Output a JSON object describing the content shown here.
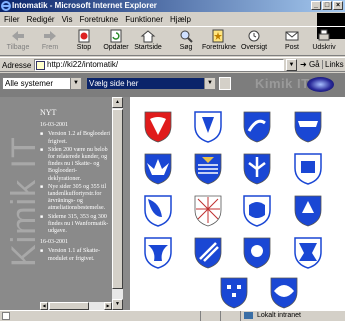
{
  "window": {
    "title": "Intomatik - Microsoft Internet Explorer"
  },
  "menu": [
    "Filer",
    "Redigér",
    "Vis",
    "Foretrukne",
    "Funktioner",
    "Hjælp"
  ],
  "toolbar": [
    {
      "label": "Tilbage",
      "icon": "back-arrow-icon",
      "disabled": true
    },
    {
      "label": "Frem",
      "icon": "forward-arrow-icon",
      "disabled": true
    },
    {
      "label": "Stop",
      "icon": "stop-icon",
      "disabled": false
    },
    {
      "label": "Opdater",
      "icon": "refresh-icon",
      "disabled": false
    },
    {
      "label": "Startside",
      "icon": "home-icon",
      "disabled": false
    },
    {
      "label": "Søg",
      "icon": "search-icon",
      "disabled": false
    },
    {
      "label": "Foretrukne",
      "icon": "favorites-icon",
      "disabled": false
    },
    {
      "label": "Oversigt",
      "icon": "history-icon",
      "disabled": false
    },
    {
      "label": "Post",
      "icon": "mail-icon",
      "disabled": false
    },
    {
      "label": "Udskriv",
      "icon": "print-icon",
      "disabled": false
    }
  ],
  "address": {
    "label": "Adresse",
    "url": "http://ki22/intomatik/",
    "go": "Gå",
    "links": "Links"
  },
  "page": {
    "system_select": "Alle systemer",
    "page_select": "Vælg side her",
    "brand": "Kimik IT",
    "vertical_brand": "Kimik IT",
    "news_heading": "NYT",
    "news": [
      {
        "date": "16-03-2001",
        "items": [
          "Version 1.2 af Boglooderi frigivet.",
          "Siden 200 være nu belob for relaterede kunder, og findes nu i Skatte- og Boglooderi-deklyrationer.",
          "Nye sider 305 og 355 til tandenlkuffortyrstr.for ärvränings- og atmeliationsbestemelse.",
          "Siderne 315, 353 og 300 findes nu i Wanformatik-udgave."
        ]
      },
      {
        "date": "16-03-2001",
        "items": [
          "Version 1.1 af Skatte-modulet er frigivet."
        ]
      }
    ]
  },
  "status": {
    "zone": "Lokalt intranet"
  },
  "colors": {
    "shield_blue": "#1a47d4",
    "shield_red": "#e01b1b",
    "panel_gray": "#8a8a8a",
    "titlebar": "#0a246a"
  }
}
